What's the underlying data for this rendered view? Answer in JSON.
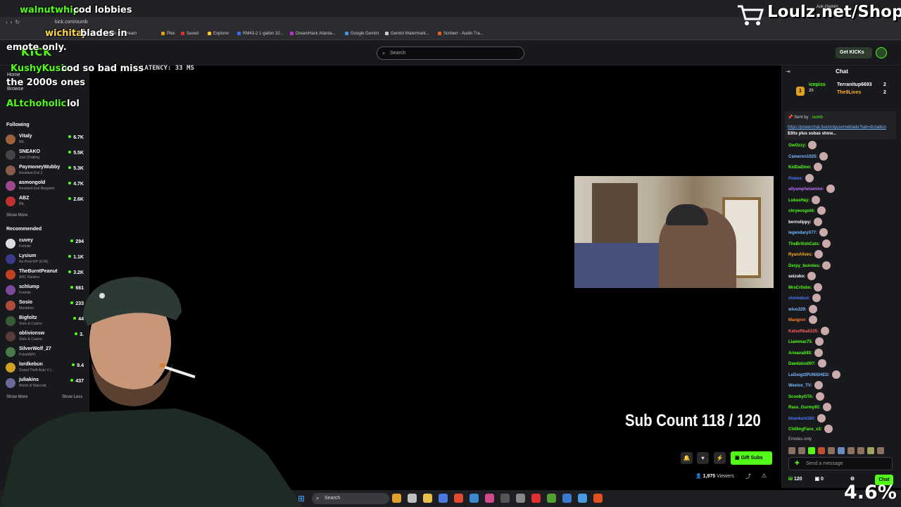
{
  "browser": {
    "url": "kick.com/oumb",
    "tab_right": "Ask Gemini",
    "bookmarks": [
      {
        "label": "Watch on Stream",
        "color": "#888888"
      },
      {
        "label": "Plex",
        "color": "#e5a00d"
      },
      {
        "label": "Saved",
        "color": "#e23030"
      },
      {
        "label": "Explorer",
        "color": "#f5c518"
      },
      {
        "label": "RM43-2 1-gallon 32...",
        "color": "#3a6ee8"
      },
      {
        "label": "DreamHack Atlanta...",
        "color": "#c22fd0"
      },
      {
        "label": "Google Gemini",
        "color": "#4a90e2"
      },
      {
        "label": "Gemini Watermark...",
        "color": "#cccccc"
      },
      {
        "label": "Scriberr - Audio Tra...",
        "color": "#e06020"
      }
    ]
  },
  "kick": {
    "logo": "KICK",
    "search_placeholder": "Search",
    "get_kicks": "Get KICKs",
    "latency": "LATENCY: 33 MS"
  },
  "sidebar": {
    "home": "Home",
    "browse": "Browse",
    "following_title": "Following",
    "following": [
      {
        "name": "Vitaly",
        "category": "IRL",
        "viewers": "6.7K",
        "color": "#a0603a"
      },
      {
        "name": "SNEAKO",
        "category": "Just Chatting",
        "viewers": "5.5K",
        "color": "#444444"
      },
      {
        "name": "PaymoneyWubby",
        "category": "Resident Evil 2",
        "viewers": "5.3K",
        "color": "#8a5a4a"
      },
      {
        "name": "asmongold",
        "category": "Resident Evil Requiem",
        "viewers": "4.7K",
        "color": "#9a4a8a"
      },
      {
        "name": "ABZ",
        "category": "IRL",
        "viewers": "2.6K",
        "color": "#c03030"
      }
    ],
    "show_more_1": "Show More",
    "recommended_title": "Recommended",
    "recommended": [
      {
        "name": "cuvey",
        "category": "Fortnite",
        "viewers": "294",
        "color": "#dddddd"
      },
      {
        "name": "Lysium",
        "category": "No Pixel RP (GTA)",
        "viewers": "1.1K",
        "color": "#3a3a8a"
      },
      {
        "name": "TheBurntPeanut",
        "category": "ARC Raiders",
        "viewers": "3.2K",
        "color": "#c04020"
      },
      {
        "name": "schlump",
        "category": "Fortnite",
        "viewers": "661",
        "color": "#7a4a9a"
      },
      {
        "name": "Sosio",
        "category": "Marathon",
        "viewers": "233",
        "color": "#b04a3a"
      },
      {
        "name": "Bigfoltz",
        "category": "Slots & Casino",
        "viewers": "44",
        "color": "#3a5a3a"
      },
      {
        "name": "oblivionsw",
        "category": "Slots & Casino",
        "viewers": "3.",
        "color": "#5a3a3a"
      },
      {
        "name": "SilverWolf_27",
        "category": "PokeMMO",
        "viewers": "",
        "color": "#4a7a4a"
      },
      {
        "name": "lordkebun",
        "category": "Grand Theft Auto V (...",
        "viewers": "9.4",
        "color": "#d0a020"
      },
      {
        "name": "juliakins",
        "category": "World of Warcraft",
        "viewers": "437",
        "color": "#6a6a9a"
      }
    ],
    "show_more_2": "Show More",
    "show_less": "Show Less"
  },
  "overlay": {
    "lines": [
      {
        "user": "walnutwhip",
        "text": "cod lobbies"
      },
      {
        "user": "wichitaj",
        "text": "blades in"
      },
      {
        "user": "",
        "text": "emote only."
      },
      {
        "user": "KushyKush",
        "text": "cod so bad miss"
      },
      {
        "user": "",
        "text": "the 2000s ones"
      },
      {
        "user": "ALtchoholic",
        "text": "lol"
      }
    ],
    "sub_count": "Sub Count  118 / 120",
    "shop": "Loulz.net/Shop",
    "percent": "4.6%"
  },
  "player_bar": {
    "gift_subs": "Gift Subs",
    "viewers_count": "1,975",
    "viewers_label": "Viewers"
  },
  "chat": {
    "title": "Chat",
    "leaderboard": [
      {
        "name": "icepiss",
        "value": "20"
      },
      {
        "name": "Terranitup6693",
        "value": "2"
      },
      {
        "name": "The9Lives",
        "value": "2"
      }
    ],
    "leader_rank": "1",
    "pinned_by": "Sent by",
    "pinned_user": "oumb",
    "pinned_link": "https://powerchat.live/onlyusemeblade?tab=donation",
    "pinned_text": "$3tts plus subas show...",
    "messages": [
      {
        "user": "OwOzzy:",
        "color": "#53fc18"
      },
      {
        "user": "Cameron1025:",
        "color": "#7ab8ff"
      },
      {
        "user": "KidDaDino:",
        "color": "#53fc18"
      },
      {
        "user": "Powez:",
        "color": "#4a7aff"
      },
      {
        "user": "allyamphetamine:",
        "color": "#c070ff"
      },
      {
        "user": "LukasHay:",
        "color": "#53fc18"
      },
      {
        "user": "chryeosgold:",
        "color": "#53fc18"
      },
      {
        "user": "bornslippy:",
        "color": "#ffffff"
      },
      {
        "user": "legendaryX77:",
        "color": "#7ab8ff"
      },
      {
        "user": "TheBritishCats:",
        "color": "#53fc18"
      },
      {
        "user": "RyanAllves:",
        "color": "#ffb020"
      },
      {
        "user": "Derpy_bunnies:",
        "color": "#53fc18"
      },
      {
        "user": "seizuko:",
        "color": "#ffffff"
      },
      {
        "user": "MrsCr0sbo:",
        "color": "#53fc18"
      },
      {
        "user": "stonedoui:",
        "color": "#4a7aff"
      },
      {
        "user": "wluo329:",
        "color": "#7ab8ff"
      },
      {
        "user": "Mangror:",
        "color": "#ff8030"
      },
      {
        "user": "Katsoftball225:",
        "color": "#ff6060"
      },
      {
        "user": "Liammac75:",
        "color": "#53fc18"
      },
      {
        "user": "Arieana593:",
        "color": "#53fc18"
      },
      {
        "user": "Daedalus007:",
        "color": "#53fc18"
      },
      {
        "user": "LeDoigt2PUNISHED:",
        "color": "#7ab8ff"
      },
      {
        "user": "Weelox_TV:",
        "color": "#7ab8ff"
      },
      {
        "user": "ScoobyGTA:",
        "color": "#53fc18"
      },
      {
        "user": "Rass_Gurmy92:",
        "color": "#53fc18"
      },
      {
        "user": "blueduck180:",
        "color": "#4a7aff"
      },
      {
        "user": "ChillingFace_x3:",
        "color": "#53fc18"
      }
    ],
    "emotes_only": "Emotes only",
    "input_placeholder": "Send a message",
    "footer_count": "120",
    "footer_zero": "0",
    "chat_button": "Chat"
  },
  "taskbar": {
    "search": "Search"
  }
}
